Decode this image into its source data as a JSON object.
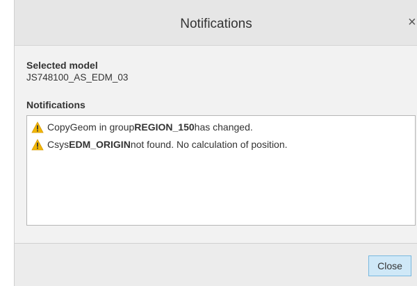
{
  "window": {
    "title": "Notifications",
    "close_glyph": "×"
  },
  "selected_model": {
    "label": "Selected model",
    "value": "JS748100_AS_EDM_03"
  },
  "notifications": {
    "label": "Notifications",
    "items": [
      {
        "icon": "warning-icon",
        "pre": "CopyGeom in group ",
        "bold": "REGION_150",
        "post": " has changed."
      },
      {
        "icon": "warning-icon",
        "pre": "Csys ",
        "bold": "EDM_ORIGIN",
        "post": " not found. No calculation of position."
      }
    ]
  },
  "footer": {
    "close_label": "Close"
  },
  "colors": {
    "warning": "#f2b705",
    "button_bg": "#cfe8f7",
    "button_border": "#78b8df"
  }
}
